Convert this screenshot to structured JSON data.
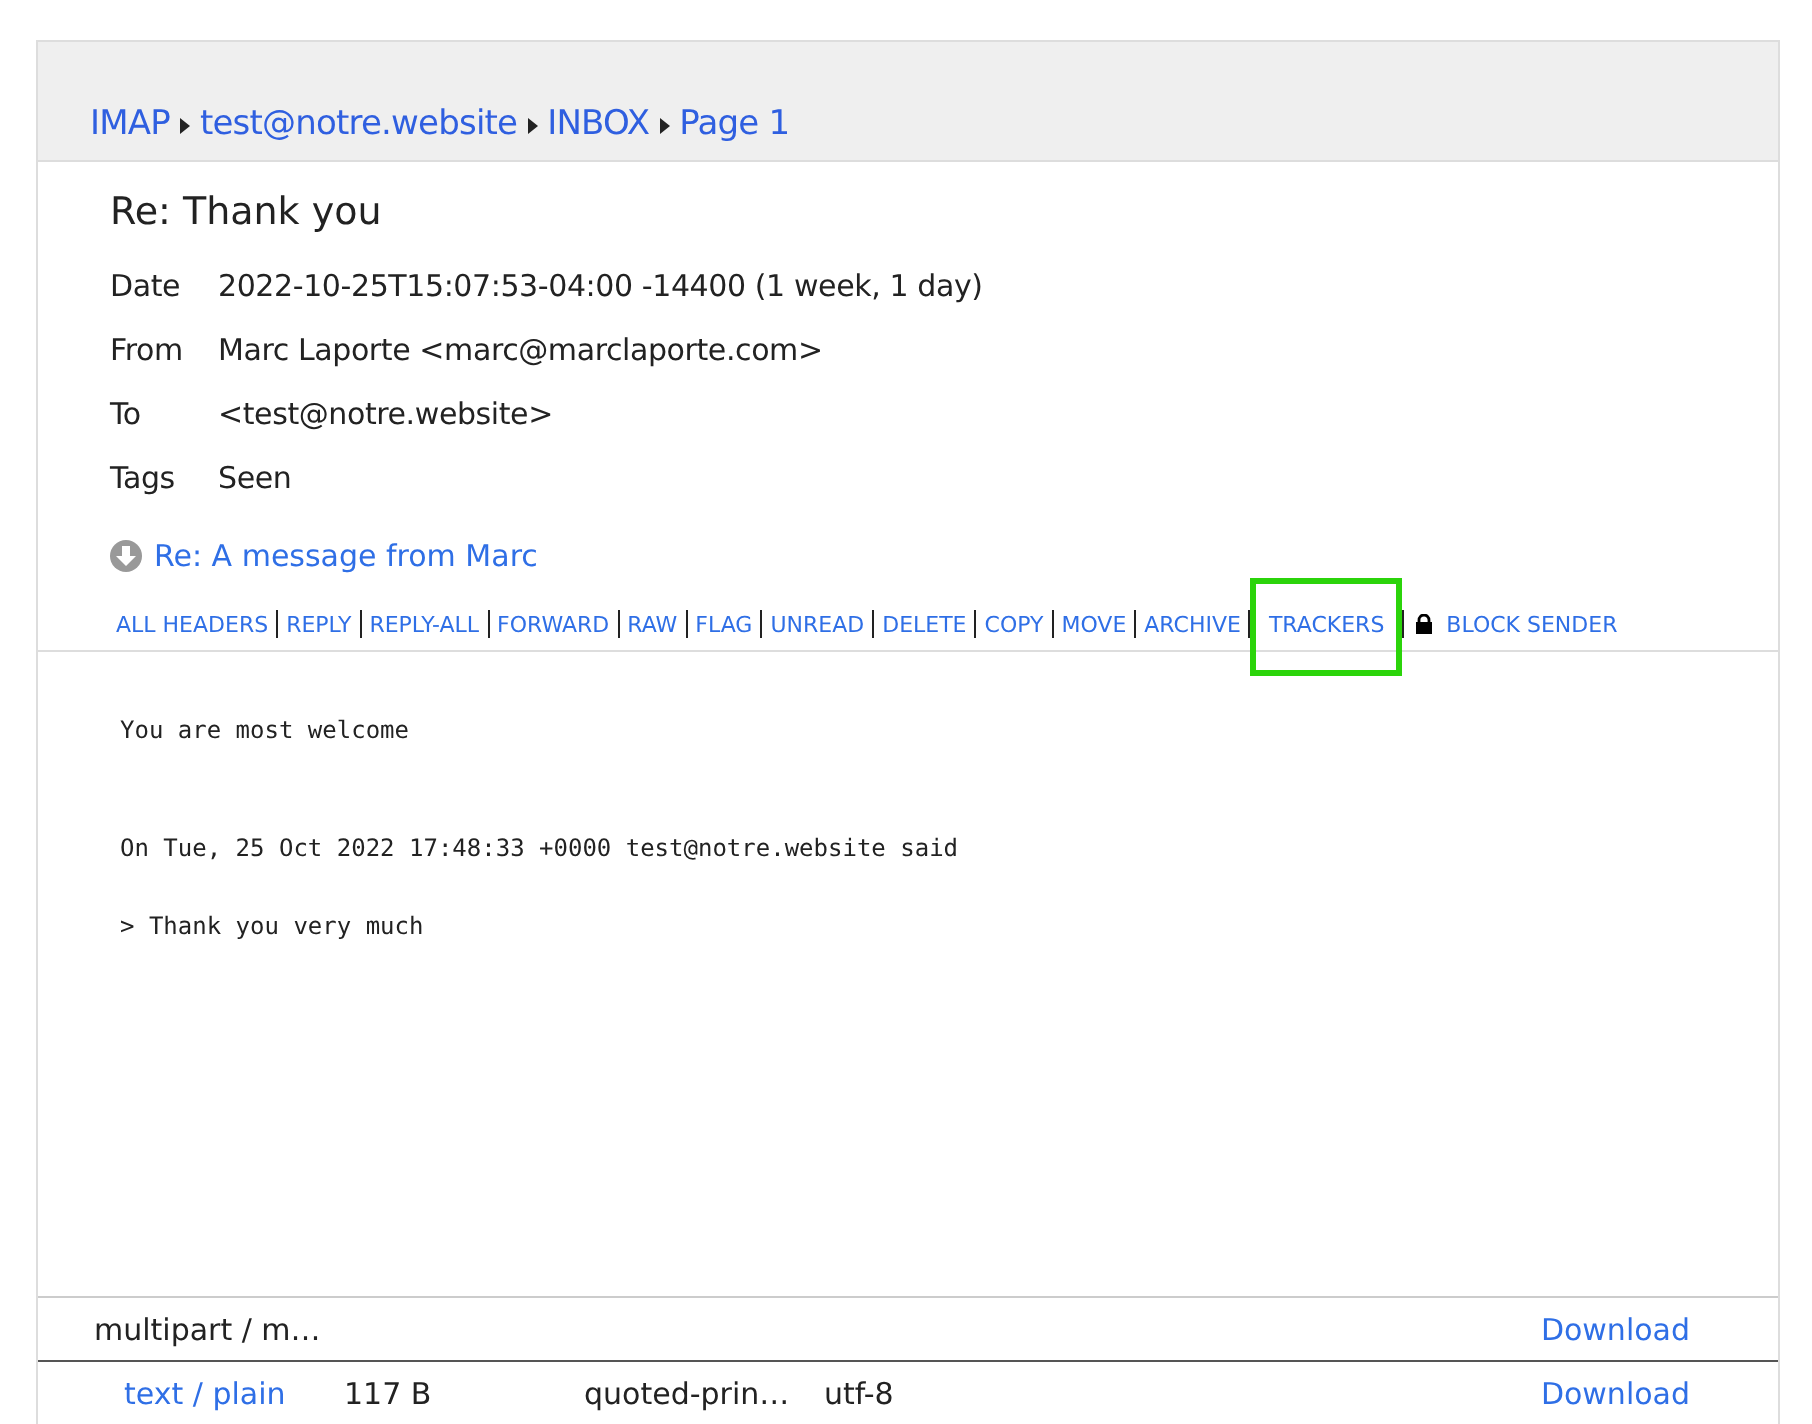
{
  "breadcrumb": [
    "IMAP",
    "test@notre.website",
    "INBOX",
    "Page 1"
  ],
  "subject": "Re: Thank you",
  "headers": [
    {
      "label": "Date",
      "value": "2022-10-25T15:07:53-04:00 -14400 (1 week, 1 day)"
    },
    {
      "label": "From",
      "value": "Marc Laporte <marc@marclaporte.com>"
    },
    {
      "label": "To",
      "value": "<test@notre.website>"
    },
    {
      "label": "Tags",
      "value": "Seen"
    }
  ],
  "parent_link": "Re: A message from Marc",
  "actions": [
    {
      "label": "ALL HEADERS",
      "highlighted": false
    },
    {
      "label": "REPLY",
      "highlighted": false
    },
    {
      "label": "REPLY-ALL",
      "highlighted": false
    },
    {
      "label": "FORWARD",
      "highlighted": false
    },
    {
      "label": "RAW",
      "highlighted": false
    },
    {
      "label": "FLAG",
      "highlighted": false
    },
    {
      "label": "UNREAD",
      "highlighted": false
    },
    {
      "label": "DELETE",
      "highlighted": false
    },
    {
      "label": "COPY",
      "highlighted": false
    },
    {
      "label": "MOVE",
      "highlighted": false
    },
    {
      "label": "ARCHIVE",
      "highlighted": false
    },
    {
      "label": "TRACKERS",
      "highlighted": true
    }
  ],
  "block_sender": "BLOCK SENDER",
  "body": [
    {
      "kind": "reply",
      "text": "You are most welcome"
    },
    {
      "kind": "attribution",
      "text": "On Tue, 25 Oct 2022 17:48:33 +0000 test@notre.website said"
    },
    {
      "kind": "quote",
      "text": "> Thank you very much"
    }
  ],
  "parts": [
    {
      "kind": "parent",
      "type": "multipart / m…",
      "download": "Download"
    },
    {
      "kind": "child",
      "type": "text / plain",
      "size": "117 B",
      "encoding": "quoted-prin…",
      "charset": "utf-8",
      "download": "Download"
    }
  ]
}
